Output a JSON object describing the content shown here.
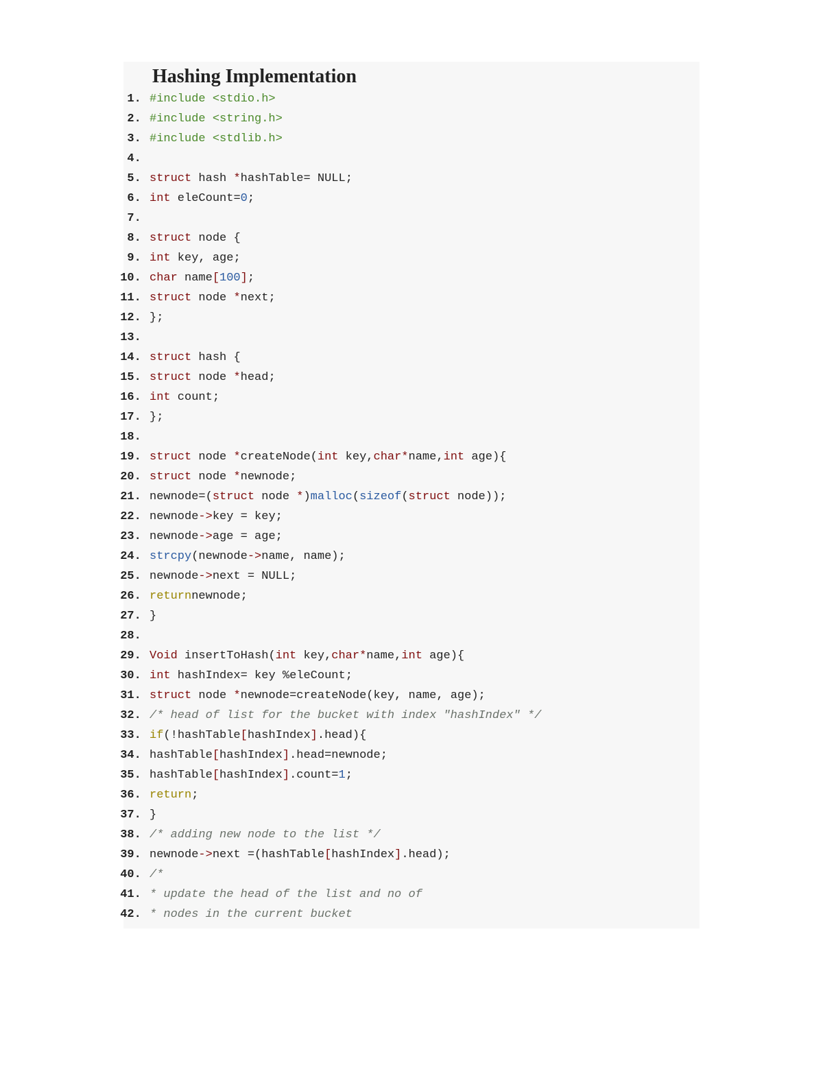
{
  "title": "Hashing Implementation",
  "colors": {
    "keyword_red": "#7f0d0d",
    "keyword_olive": "#998500",
    "preproc_green": "#4b8a2a",
    "func_blue": "#2a5aa0",
    "comment_grey": "#6a716a",
    "text_black": "#222222",
    "code_bg": "#f7f7f7"
  },
  "code_lines": [
    [
      {
        "c": "pp",
        "t": "#include <stdio.h>"
      }
    ],
    [
      {
        "c": "pp",
        "t": "#include <string.h>"
      }
    ],
    [
      {
        "c": "pp",
        "t": "#include <stdlib.h>"
      }
    ],
    [],
    [
      {
        "c": "kw",
        "t": "struct"
      },
      {
        "c": "id",
        "t": " hash "
      },
      {
        "c": "kw",
        "t": "*"
      },
      {
        "c": "id",
        "t": "hashTable"
      },
      {
        "c": "op",
        "t": "="
      },
      {
        "c": "id",
        "t": " NULL"
      },
      {
        "c": "op",
        "t": ";"
      }
    ],
    [
      {
        "c": "kw",
        "t": "int"
      },
      {
        "c": "id",
        "t": " eleCount"
      },
      {
        "c": "op",
        "t": "="
      },
      {
        "c": "num",
        "t": "0"
      },
      {
        "c": "op",
        "t": ";"
      }
    ],
    [],
    [
      {
        "c": "kw",
        "t": "struct"
      },
      {
        "c": "id",
        "t": " node "
      },
      {
        "c": "op",
        "t": "{"
      }
    ],
    [
      {
        "c": "kw",
        "t": "int"
      },
      {
        "c": "id",
        "t": " key"
      },
      {
        "c": "op",
        "t": ","
      },
      {
        "c": "id",
        "t": " age"
      },
      {
        "c": "op",
        "t": ";"
      }
    ],
    [
      {
        "c": "kw",
        "t": "char"
      },
      {
        "c": "id",
        "t": " name"
      },
      {
        "c": "bracket",
        "t": "["
      },
      {
        "c": "num",
        "t": "100"
      },
      {
        "c": "bracket",
        "t": "]"
      },
      {
        "c": "op",
        "t": ";"
      }
    ],
    [
      {
        "c": "kw",
        "t": "struct"
      },
      {
        "c": "id",
        "t": " node "
      },
      {
        "c": "kw",
        "t": "*"
      },
      {
        "c": "id",
        "t": "next"
      },
      {
        "c": "op",
        "t": ";"
      }
    ],
    [
      {
        "c": "op",
        "t": "};"
      }
    ],
    [],
    [
      {
        "c": "kw",
        "t": "struct"
      },
      {
        "c": "id",
        "t": " hash "
      },
      {
        "c": "op",
        "t": "{"
      }
    ],
    [
      {
        "c": "kw",
        "t": "struct"
      },
      {
        "c": "id",
        "t": " node "
      },
      {
        "c": "kw",
        "t": "*"
      },
      {
        "c": "id",
        "t": "head"
      },
      {
        "c": "op",
        "t": ";"
      }
    ],
    [
      {
        "c": "kw",
        "t": "int"
      },
      {
        "c": "id",
        "t": " count"
      },
      {
        "c": "op",
        "t": ";"
      }
    ],
    [
      {
        "c": "op",
        "t": "};"
      }
    ],
    [],
    [
      {
        "c": "kw",
        "t": "struct"
      },
      {
        "c": "id",
        "t": " node "
      },
      {
        "c": "kw",
        "t": "*"
      },
      {
        "c": "id",
        "t": "createNode"
      },
      {
        "c": "op",
        "t": "("
      },
      {
        "c": "kw",
        "t": "int"
      },
      {
        "c": "id",
        "t": " key"
      },
      {
        "c": "op",
        "t": ","
      },
      {
        "c": "kw",
        "t": "char*"
      },
      {
        "c": "id",
        "t": "name"
      },
      {
        "c": "op",
        "t": ","
      },
      {
        "c": "kw",
        "t": "int"
      },
      {
        "c": "id",
        "t": " age"
      },
      {
        "c": "op",
        "t": ")"
      },
      {
        "c": "op",
        "t": "{"
      }
    ],
    [
      {
        "c": "kw",
        "t": "struct"
      },
      {
        "c": "id",
        "t": " node "
      },
      {
        "c": "kw",
        "t": "*"
      },
      {
        "c": "id",
        "t": "newnode"
      },
      {
        "c": "op",
        "t": ";"
      }
    ],
    [
      {
        "c": "id",
        "t": "newnode"
      },
      {
        "c": "op",
        "t": "="
      },
      {
        "c": "op",
        "t": "("
      },
      {
        "c": "kw",
        "t": "struct"
      },
      {
        "c": "id",
        "t": " node "
      },
      {
        "c": "kw",
        "t": "*"
      },
      {
        "c": "op",
        "t": ")"
      },
      {
        "c": "fn",
        "t": "malloc"
      },
      {
        "c": "op",
        "t": "("
      },
      {
        "c": "fn",
        "t": "sizeof"
      },
      {
        "c": "op",
        "t": "("
      },
      {
        "c": "kw",
        "t": "struct"
      },
      {
        "c": "id",
        "t": " node"
      },
      {
        "c": "op",
        "t": "))"
      },
      {
        "c": "op",
        "t": ";"
      }
    ],
    [
      {
        "c": "id",
        "t": "newnode"
      },
      {
        "c": "kw",
        "t": "->"
      },
      {
        "c": "id",
        "t": "key "
      },
      {
        "c": "op",
        "t": "="
      },
      {
        "c": "id",
        "t": " key"
      },
      {
        "c": "op",
        "t": ";"
      }
    ],
    [
      {
        "c": "id",
        "t": "newnode"
      },
      {
        "c": "kw",
        "t": "->"
      },
      {
        "c": "id",
        "t": "age "
      },
      {
        "c": "op",
        "t": "="
      },
      {
        "c": "id",
        "t": " age"
      },
      {
        "c": "op",
        "t": ";"
      }
    ],
    [
      {
        "c": "fn",
        "t": "strcpy"
      },
      {
        "c": "op",
        "t": "("
      },
      {
        "c": "id",
        "t": "newnode"
      },
      {
        "c": "kw",
        "t": "->"
      },
      {
        "c": "id",
        "t": "name"
      },
      {
        "c": "op",
        "t": ","
      },
      {
        "c": "id",
        "t": " name"
      },
      {
        "c": "op",
        "t": ")"
      },
      {
        "c": "op",
        "t": ";"
      }
    ],
    [
      {
        "c": "id",
        "t": "newnode"
      },
      {
        "c": "kw",
        "t": "->"
      },
      {
        "c": "id",
        "t": "next "
      },
      {
        "c": "op",
        "t": "="
      },
      {
        "c": "id",
        "t": " NULL"
      },
      {
        "c": "op",
        "t": ";"
      }
    ],
    [
      {
        "c": "kw2",
        "t": "return"
      },
      {
        "c": "id",
        "t": "newnode"
      },
      {
        "c": "op",
        "t": ";"
      }
    ],
    [
      {
        "c": "op",
        "t": "}"
      }
    ],
    [],
    [
      {
        "c": "kw",
        "t": "Void"
      },
      {
        "c": "id",
        "t": " insertToHash"
      },
      {
        "c": "op",
        "t": "("
      },
      {
        "c": "kw",
        "t": "int"
      },
      {
        "c": "id",
        "t": " key"
      },
      {
        "c": "op",
        "t": ","
      },
      {
        "c": "kw",
        "t": "char*"
      },
      {
        "c": "id",
        "t": "name"
      },
      {
        "c": "op",
        "t": ","
      },
      {
        "c": "kw",
        "t": "int"
      },
      {
        "c": "id",
        "t": " age"
      },
      {
        "c": "op",
        "t": ")"
      },
      {
        "c": "op",
        "t": "{"
      }
    ],
    [
      {
        "c": "kw",
        "t": "int"
      },
      {
        "c": "id",
        "t": " hashIndex"
      },
      {
        "c": "op",
        "t": "="
      },
      {
        "c": "id",
        "t": " key "
      },
      {
        "c": "op",
        "t": "%"
      },
      {
        "c": "id",
        "t": "eleCount"
      },
      {
        "c": "op",
        "t": ";"
      }
    ],
    [
      {
        "c": "kw",
        "t": "struct"
      },
      {
        "c": "id",
        "t": " node "
      },
      {
        "c": "kw",
        "t": "*"
      },
      {
        "c": "id",
        "t": "newnode"
      },
      {
        "c": "op",
        "t": "="
      },
      {
        "c": "id",
        "t": "createNode"
      },
      {
        "c": "op",
        "t": "("
      },
      {
        "c": "id",
        "t": "key"
      },
      {
        "c": "op",
        "t": ","
      },
      {
        "c": "id",
        "t": " name"
      },
      {
        "c": "op",
        "t": ","
      },
      {
        "c": "id",
        "t": " age"
      },
      {
        "c": "op",
        "t": ")"
      },
      {
        "c": "op",
        "t": ";"
      }
    ],
    [
      {
        "c": "comment",
        "t": "/* head of list for the bucket with index \"hashIndex\" */"
      }
    ],
    [
      {
        "c": "kw2",
        "t": "if"
      },
      {
        "c": "op",
        "t": "("
      },
      {
        "c": "op",
        "t": "!"
      },
      {
        "c": "id",
        "t": "hashTable"
      },
      {
        "c": "bracket",
        "t": "["
      },
      {
        "c": "id",
        "t": "hashIndex"
      },
      {
        "c": "bracket",
        "t": "]"
      },
      {
        "c": "op",
        "t": "."
      },
      {
        "c": "id",
        "t": "head"
      },
      {
        "c": "op",
        "t": ")"
      },
      {
        "c": "op",
        "t": "{"
      }
    ],
    [
      {
        "c": "id",
        "t": "hashTable"
      },
      {
        "c": "bracket",
        "t": "["
      },
      {
        "c": "id",
        "t": "hashIndex"
      },
      {
        "c": "bracket",
        "t": "]"
      },
      {
        "c": "op",
        "t": "."
      },
      {
        "c": "id",
        "t": "head"
      },
      {
        "c": "op",
        "t": "="
      },
      {
        "c": "id",
        "t": "newnode"
      },
      {
        "c": "op",
        "t": ";"
      }
    ],
    [
      {
        "c": "id",
        "t": "hashTable"
      },
      {
        "c": "bracket",
        "t": "["
      },
      {
        "c": "id",
        "t": "hashIndex"
      },
      {
        "c": "bracket",
        "t": "]"
      },
      {
        "c": "op",
        "t": "."
      },
      {
        "c": "id",
        "t": "count"
      },
      {
        "c": "op",
        "t": "="
      },
      {
        "c": "num",
        "t": "1"
      },
      {
        "c": "op",
        "t": ";"
      }
    ],
    [
      {
        "c": "kw2",
        "t": "return"
      },
      {
        "c": "op",
        "t": ";"
      }
    ],
    [
      {
        "c": "op",
        "t": "}"
      }
    ],
    [
      {
        "c": "comment",
        "t": "/* adding new node to the list */"
      }
    ],
    [
      {
        "c": "id",
        "t": "newnode"
      },
      {
        "c": "kw",
        "t": "->"
      },
      {
        "c": "id",
        "t": "next "
      },
      {
        "c": "op",
        "t": "="
      },
      {
        "c": "op",
        "t": "("
      },
      {
        "c": "id",
        "t": "hashTable"
      },
      {
        "c": "bracket",
        "t": "["
      },
      {
        "c": "id",
        "t": "hashIndex"
      },
      {
        "c": "bracket",
        "t": "]"
      },
      {
        "c": "op",
        "t": "."
      },
      {
        "c": "id",
        "t": "head"
      },
      {
        "c": "op",
        "t": ")"
      },
      {
        "c": "op",
        "t": ";"
      }
    ],
    [
      {
        "c": "comment",
        "t": "/*"
      }
    ],
    [
      {
        "c": "comment",
        "t": "     * update the head of the list and no of"
      }
    ],
    [
      {
        "c": "comment",
        "t": "     * nodes in the current bucket"
      }
    ]
  ]
}
